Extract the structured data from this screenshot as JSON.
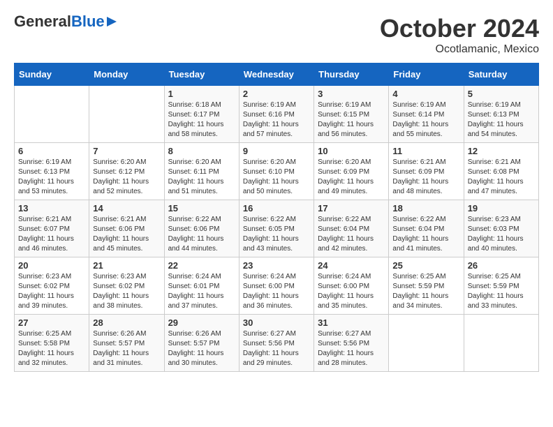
{
  "header": {
    "logo_line1": "General",
    "logo_line2": "Blue",
    "month": "October 2024",
    "location": "Ocotlamanic, Mexico"
  },
  "weekdays": [
    "Sunday",
    "Monday",
    "Tuesday",
    "Wednesday",
    "Thursday",
    "Friday",
    "Saturday"
  ],
  "weeks": [
    [
      {
        "day": "",
        "info": ""
      },
      {
        "day": "",
        "info": ""
      },
      {
        "day": "1",
        "info": "Sunrise: 6:18 AM\nSunset: 6:17 PM\nDaylight: 11 hours and 58 minutes."
      },
      {
        "day": "2",
        "info": "Sunrise: 6:19 AM\nSunset: 6:16 PM\nDaylight: 11 hours and 57 minutes."
      },
      {
        "day": "3",
        "info": "Sunrise: 6:19 AM\nSunset: 6:15 PM\nDaylight: 11 hours and 56 minutes."
      },
      {
        "day": "4",
        "info": "Sunrise: 6:19 AM\nSunset: 6:14 PM\nDaylight: 11 hours and 55 minutes."
      },
      {
        "day": "5",
        "info": "Sunrise: 6:19 AM\nSunset: 6:13 PM\nDaylight: 11 hours and 54 minutes."
      }
    ],
    [
      {
        "day": "6",
        "info": "Sunrise: 6:19 AM\nSunset: 6:13 PM\nDaylight: 11 hours and 53 minutes."
      },
      {
        "day": "7",
        "info": "Sunrise: 6:20 AM\nSunset: 6:12 PM\nDaylight: 11 hours and 52 minutes."
      },
      {
        "day": "8",
        "info": "Sunrise: 6:20 AM\nSunset: 6:11 PM\nDaylight: 11 hours and 51 minutes."
      },
      {
        "day": "9",
        "info": "Sunrise: 6:20 AM\nSunset: 6:10 PM\nDaylight: 11 hours and 50 minutes."
      },
      {
        "day": "10",
        "info": "Sunrise: 6:20 AM\nSunset: 6:09 PM\nDaylight: 11 hours and 49 minutes."
      },
      {
        "day": "11",
        "info": "Sunrise: 6:21 AM\nSunset: 6:09 PM\nDaylight: 11 hours and 48 minutes."
      },
      {
        "day": "12",
        "info": "Sunrise: 6:21 AM\nSunset: 6:08 PM\nDaylight: 11 hours and 47 minutes."
      }
    ],
    [
      {
        "day": "13",
        "info": "Sunrise: 6:21 AM\nSunset: 6:07 PM\nDaylight: 11 hours and 46 minutes."
      },
      {
        "day": "14",
        "info": "Sunrise: 6:21 AM\nSunset: 6:06 PM\nDaylight: 11 hours and 45 minutes."
      },
      {
        "day": "15",
        "info": "Sunrise: 6:22 AM\nSunset: 6:06 PM\nDaylight: 11 hours and 44 minutes."
      },
      {
        "day": "16",
        "info": "Sunrise: 6:22 AM\nSunset: 6:05 PM\nDaylight: 11 hours and 43 minutes."
      },
      {
        "day": "17",
        "info": "Sunrise: 6:22 AM\nSunset: 6:04 PM\nDaylight: 11 hours and 42 minutes."
      },
      {
        "day": "18",
        "info": "Sunrise: 6:22 AM\nSunset: 6:04 PM\nDaylight: 11 hours and 41 minutes."
      },
      {
        "day": "19",
        "info": "Sunrise: 6:23 AM\nSunset: 6:03 PM\nDaylight: 11 hours and 40 minutes."
      }
    ],
    [
      {
        "day": "20",
        "info": "Sunrise: 6:23 AM\nSunset: 6:02 PM\nDaylight: 11 hours and 39 minutes."
      },
      {
        "day": "21",
        "info": "Sunrise: 6:23 AM\nSunset: 6:02 PM\nDaylight: 11 hours and 38 minutes."
      },
      {
        "day": "22",
        "info": "Sunrise: 6:24 AM\nSunset: 6:01 PM\nDaylight: 11 hours and 37 minutes."
      },
      {
        "day": "23",
        "info": "Sunrise: 6:24 AM\nSunset: 6:00 PM\nDaylight: 11 hours and 36 minutes."
      },
      {
        "day": "24",
        "info": "Sunrise: 6:24 AM\nSunset: 6:00 PM\nDaylight: 11 hours and 35 minutes."
      },
      {
        "day": "25",
        "info": "Sunrise: 6:25 AM\nSunset: 5:59 PM\nDaylight: 11 hours and 34 minutes."
      },
      {
        "day": "26",
        "info": "Sunrise: 6:25 AM\nSunset: 5:59 PM\nDaylight: 11 hours and 33 minutes."
      }
    ],
    [
      {
        "day": "27",
        "info": "Sunrise: 6:25 AM\nSunset: 5:58 PM\nDaylight: 11 hours and 32 minutes."
      },
      {
        "day": "28",
        "info": "Sunrise: 6:26 AM\nSunset: 5:57 PM\nDaylight: 11 hours and 31 minutes."
      },
      {
        "day": "29",
        "info": "Sunrise: 6:26 AM\nSunset: 5:57 PM\nDaylight: 11 hours and 30 minutes."
      },
      {
        "day": "30",
        "info": "Sunrise: 6:27 AM\nSunset: 5:56 PM\nDaylight: 11 hours and 29 minutes."
      },
      {
        "day": "31",
        "info": "Sunrise: 6:27 AM\nSunset: 5:56 PM\nDaylight: 11 hours and 28 minutes."
      },
      {
        "day": "",
        "info": ""
      },
      {
        "day": "",
        "info": ""
      }
    ]
  ]
}
